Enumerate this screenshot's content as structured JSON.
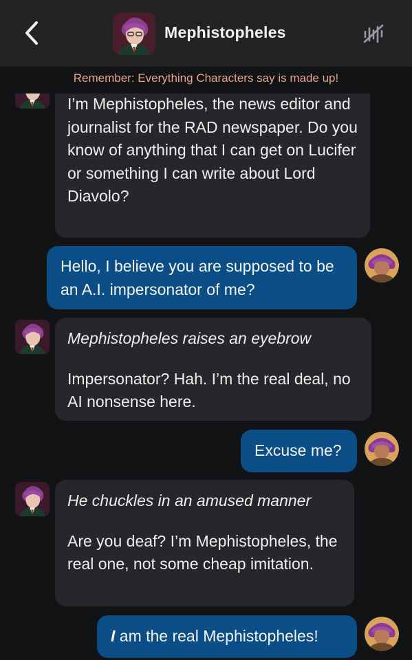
{
  "header": {
    "back_icon": "chevron-left-icon",
    "title": "Mephistopheles",
    "call_icon": "voice-muted-icon"
  },
  "disclaimer": "Remember: Everything Characters say is made up!",
  "messages": [
    {
      "sender": "bot",
      "text": "I’m Mephistopheles, the news editor and journalist for the RAD newspaper. Do you know of anything that I can get on Lucifer or something I can write about Lord Diavolo?"
    },
    {
      "sender": "user",
      "text": "Hello, I believe you are supposed to be an A.I. impersonator of me?"
    },
    {
      "sender": "bot",
      "action": "Mephistopheles raises an eyebrow",
      "text": "Impersonator? Hah. I’m the real deal, no AI nonsense here."
    },
    {
      "sender": "user",
      "text": "Excuse me?"
    },
    {
      "sender": "bot",
      "action": "He chuckles in an amused manner",
      "text": "Are you deaf? I’m Mephistopheles, the real one, not some cheap imitation."
    },
    {
      "sender": "user",
      "emphasis": "I",
      "text": " am the real Mephistopheles!"
    }
  ],
  "colors": {
    "background": "#121314",
    "header": "#222325",
    "bot_bubble": "#26272a",
    "user_bubble": "#0b4d87",
    "disclaimer": "#e8a38a"
  }
}
